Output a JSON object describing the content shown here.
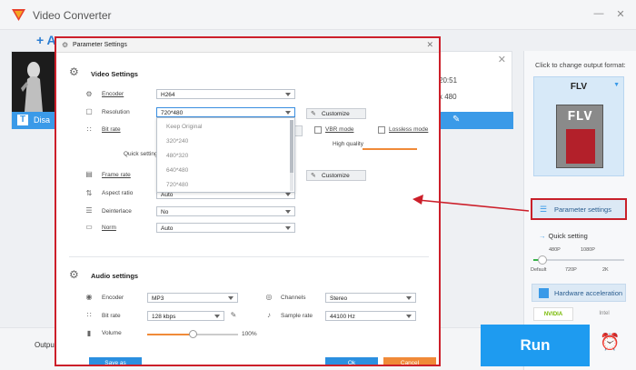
{
  "app": {
    "title": "Video Converter"
  },
  "toolbar": {
    "add_label": "+ A"
  },
  "file": {
    "duration": "20:51",
    "resolution": "x 480",
    "subtitle_label": "Disa"
  },
  "right_panel": {
    "hint": "Click to change output format:",
    "format": "FLV",
    "format_icon_text": "FLV",
    "param_button": "Parameter settings",
    "quick_setting": "Quick setting",
    "qs_top_labels": [
      "480P",
      "1080P"
    ],
    "qs_bottom_labels": [
      "Default",
      "720P",
      "2K"
    ],
    "qs_level": 0.1,
    "hw_accel": "Hardware acceleration",
    "nvidia": "NVIDIA",
    "intel": "Intel"
  },
  "bottom": {
    "output_label": "Outpu",
    "run_label": "Run"
  },
  "dialog": {
    "title": "Parameter Settings",
    "video_section": "Video Settings",
    "encoder_label": "Encoder",
    "encoder_value": "H264",
    "resolution_label": "Resolution",
    "resolution_value": "720*480",
    "customize": "Customize",
    "bitrate_label": "Bit rate",
    "bitrate_partial": "ize",
    "vbr_label": "VBR mode",
    "lossless_label": "Lossless mode",
    "quick_setting": "Quick setting",
    "high_quality": "High quality",
    "framerate_label": "Frame rate",
    "aspect_label": "Aspect ratio",
    "aspect_value": "Auto",
    "deinterlace_label": "Deinterlace",
    "deinterlace_value": "No",
    "norm_label": "Norm",
    "norm_value": "Auto",
    "resolution_options": [
      "Keep Original",
      "320*240",
      "480*320",
      "640*480",
      "720*480"
    ],
    "audio_section": "Audio settings",
    "a_encoder_label": "Encoder",
    "a_encoder_value": "MP3",
    "channels_label": "Channels",
    "channels_value": "Stereo",
    "a_bitrate_label": "Bit rate",
    "a_bitrate_value": "128 kbps",
    "sample_label": "Sample rate",
    "sample_value": "44100 Hz",
    "volume_label": "Volume",
    "volume_value": "100%",
    "volume_level": 0.5,
    "save_as": "Save as",
    "ok": "Ok",
    "cancel": "Cancel"
  },
  "colors": {
    "accent": "#1e9bf0",
    "highlight_border": "#cc1f2a",
    "orange": "#f08a38",
    "green": "#37b34a"
  }
}
